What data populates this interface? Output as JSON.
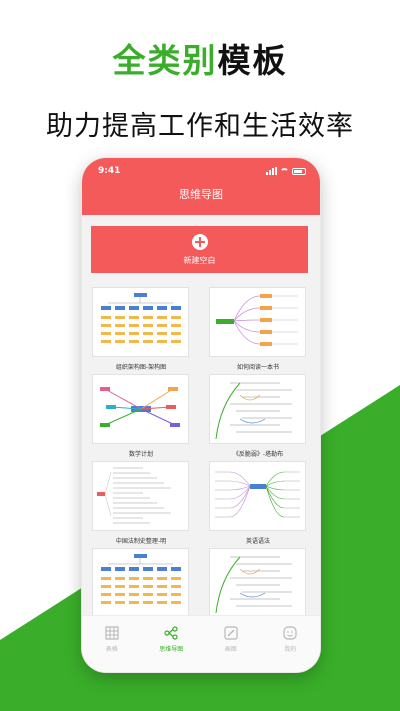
{
  "promo": {
    "headline_green": "全类别",
    "headline_black": "模板",
    "subline": "助力提高工作和生活效率"
  },
  "status": {
    "time": "9:41"
  },
  "app": {
    "title": "思维导图",
    "new_blank": "新建空白"
  },
  "templates": [
    {
      "name": "组织架构图-架构图",
      "style": "org"
    },
    {
      "name": "如何阅读一本书",
      "style": "tree"
    },
    {
      "name": "数学计划",
      "style": "radial"
    },
    {
      "name": "《反脆弱》-塔勒布",
      "style": "outline"
    },
    {
      "name": "中国法制史整理-明",
      "style": "doc"
    },
    {
      "name": "英语语法",
      "style": "branch"
    },
    {
      "name": "",
      "style": "org"
    },
    {
      "name": "",
      "style": "outline"
    }
  ],
  "tabs": [
    {
      "label": "表格",
      "icon": "table-icon",
      "active": false
    },
    {
      "label": "思维导图",
      "icon": "mindmap-icon",
      "active": true
    },
    {
      "label": "画图",
      "icon": "draw-icon",
      "active": false
    },
    {
      "label": "我的",
      "icon": "profile-icon",
      "active": false
    }
  ],
  "colors": {
    "accent_red": "#f45a5a",
    "brand_green": "#3aae2a"
  }
}
